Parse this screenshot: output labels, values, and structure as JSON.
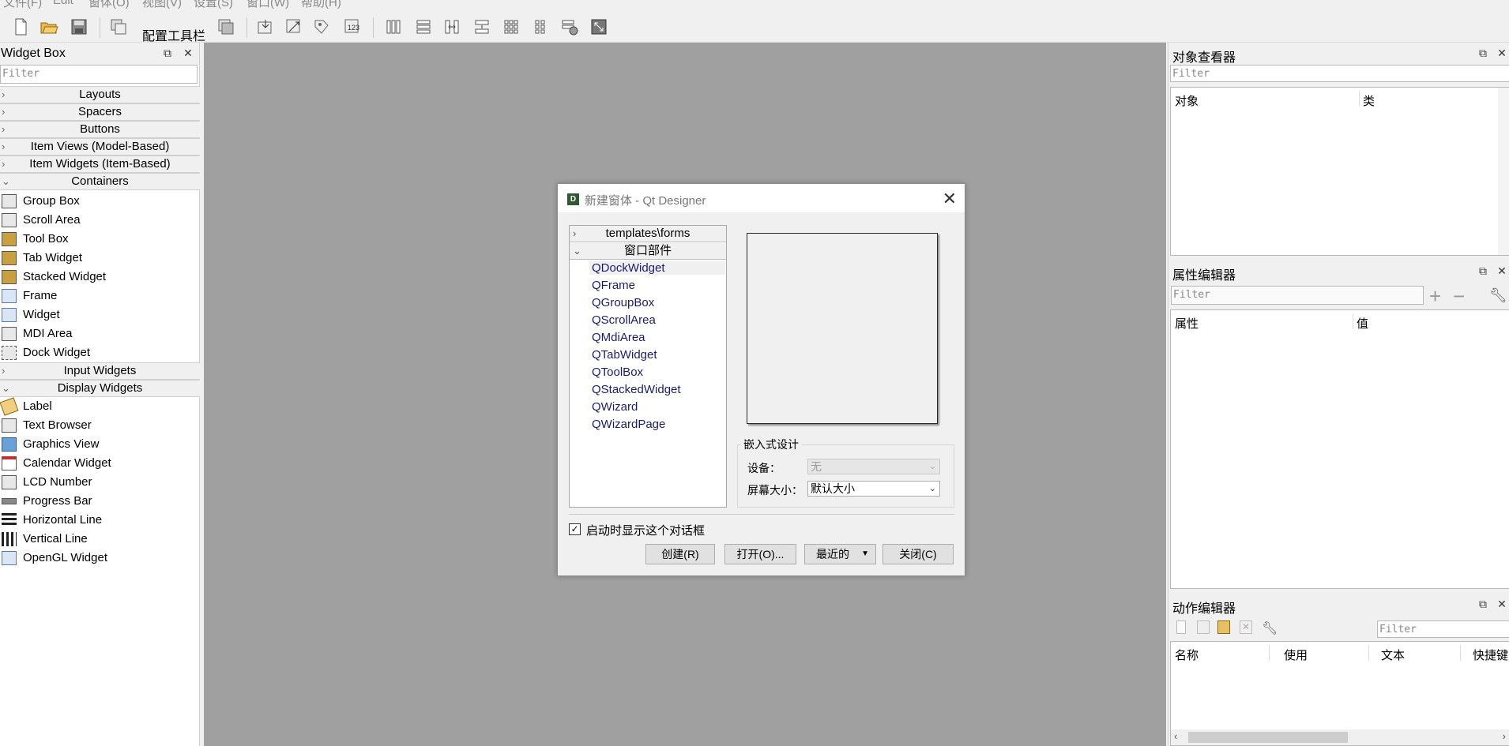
{
  "menubar": {
    "items": [
      "文件(F)",
      "Edit",
      "窗体(O)",
      "视图(V)",
      "设置(S)",
      "窗口(W)",
      "帮助(H)"
    ]
  },
  "toolbar": {
    "config_label": "配置工具栏"
  },
  "widget_box": {
    "title": "Widget Box",
    "filter_placeholder": "Filter",
    "categories": {
      "layouts": "Layouts",
      "spacers": "Spacers",
      "buttons": "Buttons",
      "item_views": "Item Views (Model-Based)",
      "item_widgets": "Item Widgets (Item-Based)",
      "containers": "Containers",
      "input_widgets": "Input Widgets",
      "display_widgets": "Display Widgets"
    },
    "containers": [
      "Group Box",
      "Scroll Area",
      "Tool Box",
      "Tab Widget",
      "Stacked Widget",
      "Frame",
      "Widget",
      "MDI Area",
      "Dock Widget"
    ],
    "display_widgets": [
      "Label",
      "Text Browser",
      "Graphics View",
      "Calendar Widget",
      "LCD Number",
      "Progress Bar",
      "Horizontal Line",
      "Vertical Line",
      "OpenGL Widget"
    ]
  },
  "object_inspector": {
    "title": "对象查看器",
    "filter_placeholder": "Filter",
    "col_object": "对象",
    "col_class": "类"
  },
  "property_editor": {
    "title": "属性编辑器",
    "filter_placeholder": "Filter",
    "col_property": "属性",
    "col_value": "值"
  },
  "action_editor": {
    "title": "动作编辑器",
    "filter_placeholder": "Filter",
    "col_name": "名称",
    "col_used": "使用",
    "col_text": "文本",
    "col_shortcut": "快捷键"
  },
  "dialog": {
    "title": "新建窗体 - Qt Designer",
    "icon_letter": "D",
    "tree": {
      "cat_templates": "templates\\forms",
      "cat_widgets": "窗口部件",
      "items": [
        "QDockWidget",
        "QFrame",
        "QGroupBox",
        "QScrollArea",
        "QMdiArea",
        "QTabWidget",
        "QToolBox",
        "QStackedWidget",
        "QWizard",
        "QWizardPage"
      ]
    },
    "embedded_design": {
      "group_title": "嵌入式设计",
      "device_label": "设备：",
      "device_value": "无",
      "screen_size_label": "屏幕大小：",
      "screen_size_value": "默认大小"
    },
    "show_on_startup_label": "启动时显示这个对话框",
    "show_on_startup_checked": true,
    "buttons": {
      "create": "创建(R)",
      "open": "打开(O)...",
      "recent": "最近的",
      "close": "关闭(C)"
    }
  }
}
